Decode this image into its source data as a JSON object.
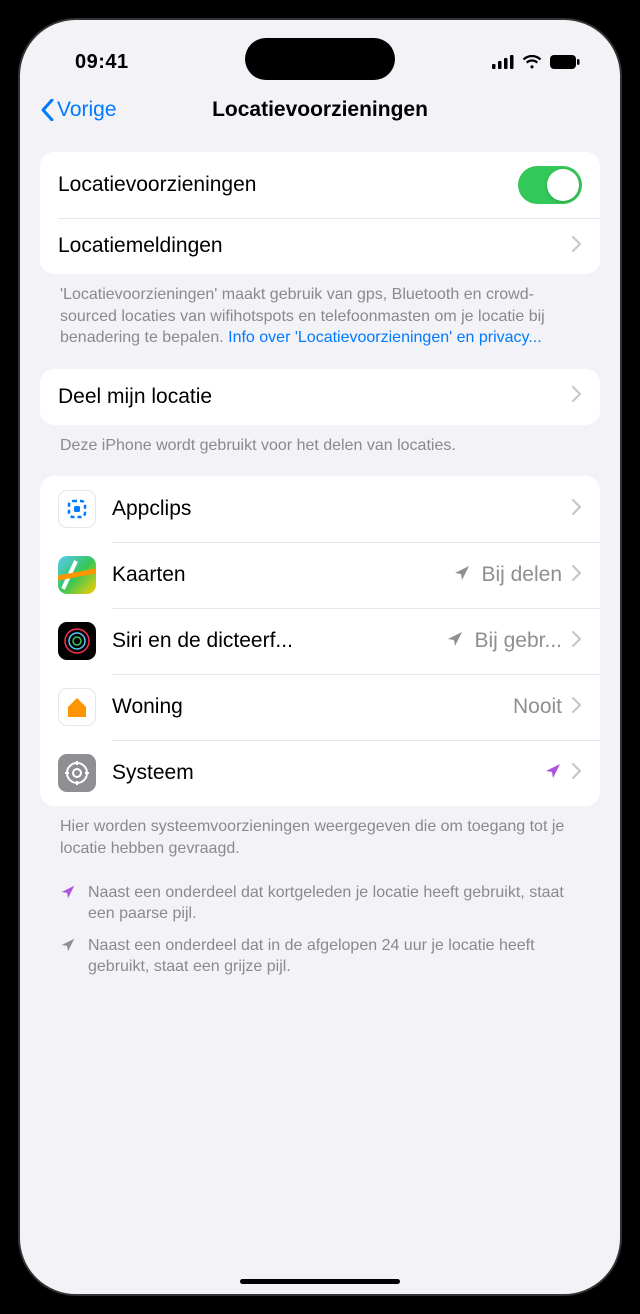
{
  "status": {
    "time": "09:41"
  },
  "nav": {
    "back": "Vorige",
    "title": "Locatievoorzieningen"
  },
  "main_toggle": {
    "label": "Locatievoorzieningen"
  },
  "alerts": {
    "label": "Locatiemeldingen"
  },
  "description": {
    "text": "'Locatievoorzieningen' maakt gebruik van gps, Bluetooth en crowd-sourced locaties van wifihotspots en telefoonmasten om je locatie bij benadering te bepalen. ",
    "link": "Info over 'Locatievoorzieningen' en privacy..."
  },
  "share": {
    "label": "Deel mijn locatie",
    "footer": "Deze iPhone wordt gebruikt voor het delen van locaties."
  },
  "apps": {
    "items": [
      {
        "name": "Appclips",
        "value": "",
        "indicator": ""
      },
      {
        "name": "Kaarten",
        "value": "Bij delen",
        "indicator": "grey"
      },
      {
        "name": "Siri en de dicteerf...",
        "value": "Bij gebr...",
        "indicator": "grey"
      },
      {
        "name": "Woning",
        "value": "Nooit",
        "indicator": ""
      },
      {
        "name": "Systeem",
        "value": "",
        "indicator": "purple"
      }
    ],
    "footer": "Hier worden systeemvoorzieningen weergegeven die om toegang tot je locatie hebben gevraagd."
  },
  "legend": {
    "purple": "Naast een onderdeel dat kortgeleden je locatie heeft gebruikt, staat een paarse pijl.",
    "grey": "Naast een onderdeel dat in de afgelopen 24 uur je locatie heeft gebruikt, staat een grijze pijl."
  }
}
